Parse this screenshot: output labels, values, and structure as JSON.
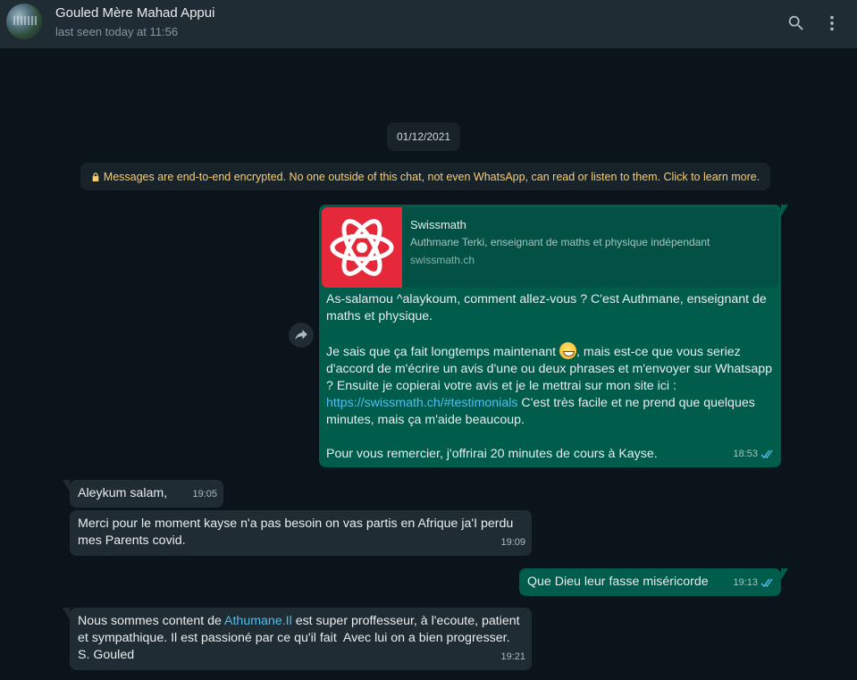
{
  "header": {
    "contact_name": "Gouled Mère Mahad Appui",
    "status": "last seen today at 11:56",
    "search_icon": "search-icon",
    "menu_icon": "kebab-menu-icon"
  },
  "chat": {
    "date": "01/12/2021",
    "encryption_notice": "Messages are end-to-end encrypted. No one outside of this chat, not even WhatsApp, can read or listen to them. Click to learn more.",
    "messages": [
      {
        "direction": "out",
        "link_preview": {
          "title": "Swissmath",
          "description": "Authmane Terki, enseignant de maths et physique indépendant",
          "domain": "swissmath.ch"
        },
        "p1": "As-salamou ^alaykoum, comment allez-vous ? C'est Authmane, enseignant de maths et physique.",
        "p2a": "Je sais que ça fait longtemps maintenant ",
        "p2b": ", mais est-ce que vous seriez d'accord de m'écrire un avis d'une ou deux phrases et m'envoyer sur Whatsapp ? Ensuite je copierai votre avis et je le mettrai sur mon site ici :",
        "link": "https://swissmath.ch/#testimonials",
        "p3": " C'est très facile et ne prend que quelques minutes, mais ça m'aide beaucoup.",
        "p4": "Pour vous remercier, j'offrirai 20 minutes de cours à Kayse.",
        "time": "18:53",
        "status": "read"
      },
      {
        "direction": "in",
        "text": "Aleykum salam,",
        "time": "19:05"
      },
      {
        "direction": "in",
        "text": "Merci  pour le moment kayse n'a pas besoin on vas partis en Afrique ja'I perdu mes Parents covid.",
        "time": "19:09"
      },
      {
        "direction": "out",
        "text": "Que Dieu leur fasse miséricorde",
        "time": "19:13",
        "status": "read"
      },
      {
        "direction": "in",
        "text_a": "Nous sommes content de ",
        "mention": "Athumane.Il",
        "text_b": " est super proffesseur, à l'ecoute, patient et sympathique. Il est passioné par ce qu'il fait  Avec lui on a bien progresser.",
        "text_c": "S. Gouled",
        "time": "19:21"
      }
    ]
  },
  "colors": {
    "header_bg": "#202c33",
    "chat_bg": "#0b141a",
    "outgoing_bg": "#005c4b",
    "incoming_bg": "#202c33",
    "link": "#53bdeb",
    "read_ticks": "#53bdeb",
    "encryption_text": "#f7cd73"
  }
}
